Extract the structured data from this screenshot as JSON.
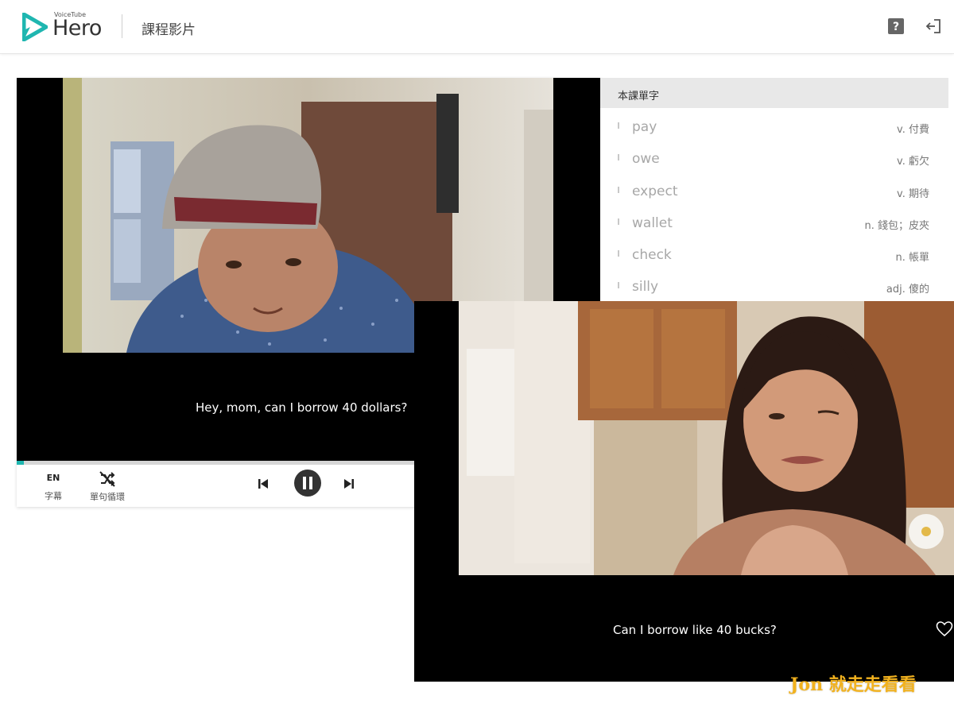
{
  "header": {
    "logo_small": "VoiceTube",
    "logo_text": "Hero",
    "page_title": "課程影片",
    "help_icon": "question-mark-icon",
    "logout_icon": "logout-icon"
  },
  "player1": {
    "subtitle": "Hey, mom, can I borrow 40 dollars?",
    "progress": 0.012,
    "controls": {
      "language_code": "EN",
      "language_label": "字幕",
      "loop_label": "單句循環",
      "loop_icon": "shuffle-off-icon",
      "prev_icon": "skip-previous-icon",
      "pause_icon": "pause-icon",
      "next_icon": "skip-next-icon"
    }
  },
  "vocabulary": {
    "title": "本課單字",
    "items": [
      {
        "word": "pay",
        "definition": "v. 付費"
      },
      {
        "word": "owe",
        "definition": "v. 虧欠"
      },
      {
        "word": "expect",
        "definition": "v. 期待"
      },
      {
        "word": "wallet",
        "definition": "n. 錢包；皮夾"
      },
      {
        "word": "check",
        "definition": "n. 帳單"
      },
      {
        "word": "silly",
        "definition": "adj. 傻的"
      }
    ]
  },
  "player2": {
    "subtitle": "Can I borrow like 40 bucks?",
    "favorite_icon": "heart-icon"
  },
  "watermark": "Jon 就走走看看",
  "colors": {
    "accent": "#1fb6b0",
    "watermark": "#f2b21e",
    "video_bg": "#000000"
  }
}
